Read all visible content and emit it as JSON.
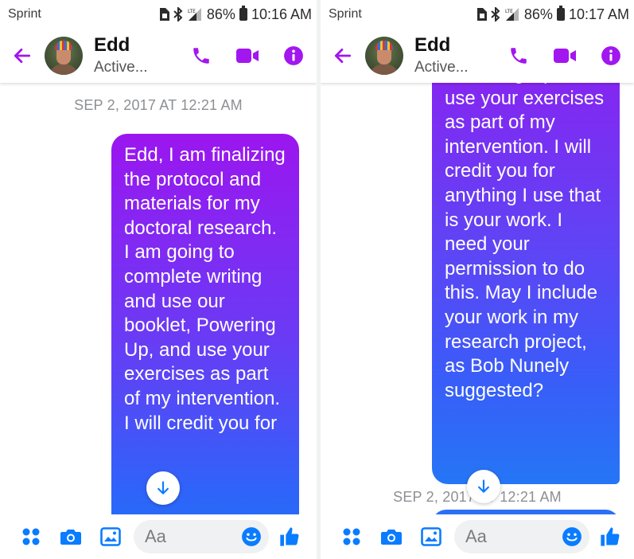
{
  "theme": {
    "accent": "#a216ef",
    "messenger_blue": "#0a7cff",
    "timestamp_gray": "#8d8f93"
  },
  "icons": {
    "back": "arrow-left-icon",
    "call": "phone-icon",
    "video": "video-camera-icon",
    "info": "info-icon",
    "scroll_down": "arrow-down-icon",
    "apps": "four-dots-icon",
    "camera": "camera-icon",
    "gallery": "image-icon",
    "emoji": "smiley-icon",
    "like": "thumbs-up-icon",
    "bluetooth": "bluetooth-icon",
    "signal": "lte-signal-icon",
    "battery": "battery-icon",
    "sim": "sim-icon"
  },
  "screens": [
    {
      "status_bar": {
        "carrier": "Sprint",
        "battery": "86%",
        "time": "10:16 AM"
      },
      "header": {
        "name": "Edd",
        "status": "Active..."
      },
      "timestamp": "SEP 2, 2017 AT 12:21 AM",
      "message": "Edd, I am finalizing the protocol and materials for my doctoral research.   I am going to complete writing and use our booklet, Powering Up, and use your exercises as part of my intervention. I will credit you for",
      "composer": {
        "placeholder": "Aa"
      }
    },
    {
      "status_bar": {
        "carrier": "Sprint",
        "battery": "86%",
        "time": "10:17 AM"
      },
      "header": {
        "name": "Edd",
        "status": "Active..."
      },
      "timestamp": "SEP 2, 2017 AT 12:21 AM",
      "message": "Powering Up, and use your exercises as part of my intervention. I will credit you for anything I use that is your work. I need your permission to do this. May I include your work in my research project, as Bob Nunely suggested?",
      "composer": {
        "placeholder": "Aa"
      }
    }
  ]
}
